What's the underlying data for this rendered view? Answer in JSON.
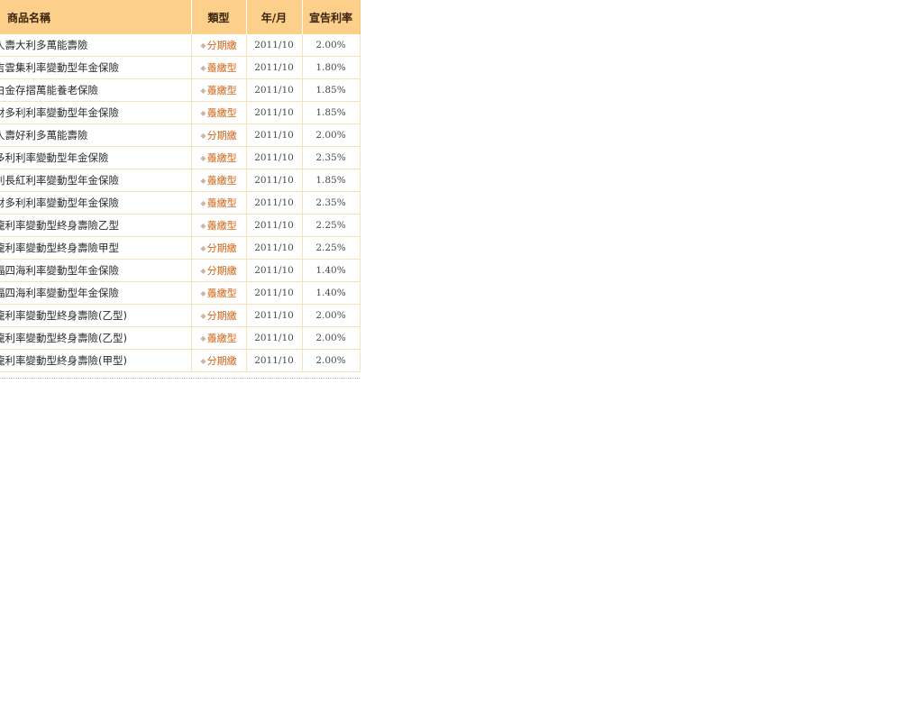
{
  "table": {
    "headers": {
      "name": "商品名稱",
      "type": "類型",
      "year_month": "年/月",
      "rate": "宣告利率"
    },
    "rows": [
      {
        "name": "人壽大利多萬能壽險",
        "type": "分期繳",
        "year_month": "2011/10",
        "rate": "2.00%"
      },
      {
        "name": "吉雲集利率變動型年金保險",
        "type": "躉繳型",
        "year_month": "2011/10",
        "rate": "1.80%"
      },
      {
        "name": "白金存摺萬能養老保險",
        "type": "躉繳型",
        "year_month": "2011/10",
        "rate": "1.85%"
      },
      {
        "name": "財多利利率變動型年金保險",
        "type": "躉繳型",
        "year_month": "2011/10",
        "rate": "1.85%"
      },
      {
        "name": "人壽好利多萬能壽險",
        "type": "分期繳",
        "year_month": "2011/10",
        "rate": "2.00%"
      },
      {
        "name": "多利利率變動型年金保險",
        "type": "躉繳型",
        "year_month": "2011/10",
        "rate": "2.35%"
      },
      {
        "name": "利長紅利率變動型年金保險",
        "type": "躉繳型",
        "year_month": "2011/10",
        "rate": "1.85%"
      },
      {
        "name": "財多利利率變動型年金保險",
        "type": "躉繳型",
        "year_month": "2011/10",
        "rate": "2.35%"
      },
      {
        "name": "龍利率變動型終身壽險乙型",
        "type": "躉繳型",
        "year_month": "2011/10",
        "rate": "2.25%"
      },
      {
        "name": "龍利率變動型終身壽險甲型",
        "type": "分期繳",
        "year_month": "2011/10",
        "rate": "2.25%"
      },
      {
        "name": "福四海利率變動型年金保險",
        "type": "分期繳",
        "year_month": "2011/10",
        "rate": "1.40%"
      },
      {
        "name": "福四海利率變動型年金保險",
        "type": "躉繳型",
        "year_month": "2011/10",
        "rate": "1.40%"
      },
      {
        "name": "龍利率變動型終身壽險(乙型)",
        "type": "分期繳",
        "year_month": "2011/10",
        "rate": "2.00%"
      },
      {
        "name": "龍利率變動型終身壽險(乙型)",
        "type": "躉繳型",
        "year_month": "2011/10",
        "rate": "2.00%"
      },
      {
        "name": "龍利率變動型終身壽險(甲型)",
        "type": "分期繳",
        "year_month": "2011/10",
        "rate": "2.00%"
      }
    ],
    "icons": {
      "type_bullet": "diamond-icon"
    },
    "colors": {
      "header_bg": "#fcd08a",
      "type_link": "#d06418",
      "row_border": "#f5e3c0"
    }
  }
}
